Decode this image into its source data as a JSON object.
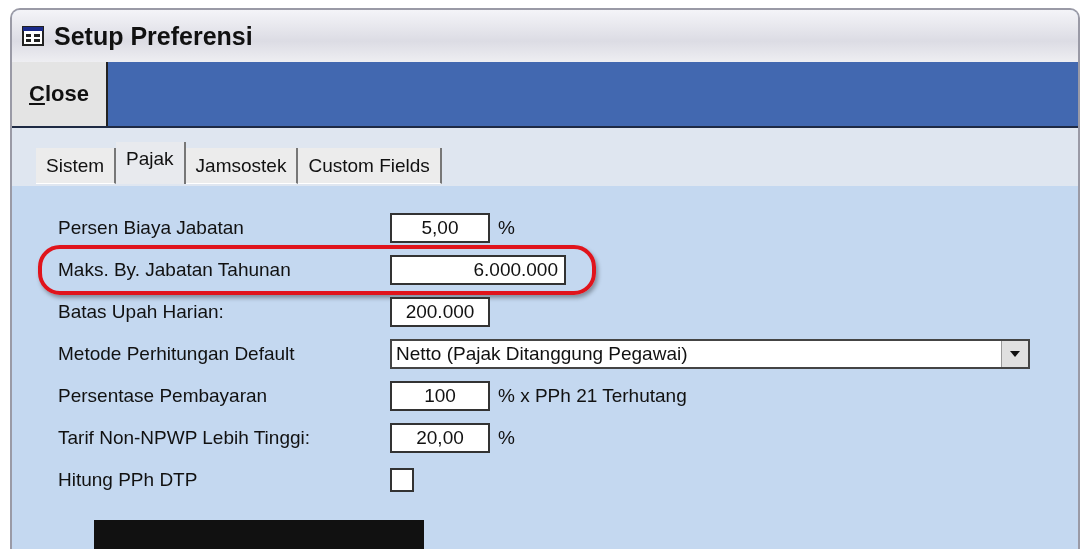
{
  "window": {
    "title": "Setup Preferensi"
  },
  "toolbar": {
    "buttons": [
      {
        "label": "Close"
      }
    ]
  },
  "tabs": [
    {
      "label": "Sistem",
      "selected": false
    },
    {
      "label": "Pajak",
      "selected": true
    },
    {
      "label": "Jamsostek",
      "selected": false
    },
    {
      "label": "Custom Fields",
      "selected": false
    }
  ],
  "fields": [
    {
      "kind": "field",
      "label": "Persen Biaya Jabatan",
      "value": "5,00",
      "suffix": "%",
      "wide": false,
      "highlighted": false
    },
    {
      "kind": "field",
      "label": "Maks. By. Jabatan Tahunan",
      "value": "6.000.000",
      "wide": true,
      "highlighted": true
    },
    {
      "kind": "field",
      "label": "Batas Upah Harian:",
      "value": "200.000",
      "wide": false,
      "highlighted": false
    },
    {
      "kind": "dropdown",
      "label": "Metode Perhitungan Default",
      "value": "Netto (Pajak Ditanggung Pegawai)",
      "highlighted": false
    },
    {
      "kind": "field",
      "label": "Persentase Pembayaran",
      "value": "100",
      "suffix": "% x PPh 21 Terhutang",
      "wide": false,
      "highlighted": false
    },
    {
      "kind": "field",
      "label": "Tarif Non-NPWP Lebih Tinggi:",
      "value": "20,00",
      "suffix": "%",
      "wide": false,
      "highlighted": false
    },
    {
      "kind": "checkbox",
      "label": "Hitung PPh DTP",
      "checked": false,
      "highlighted": false
    }
  ]
}
